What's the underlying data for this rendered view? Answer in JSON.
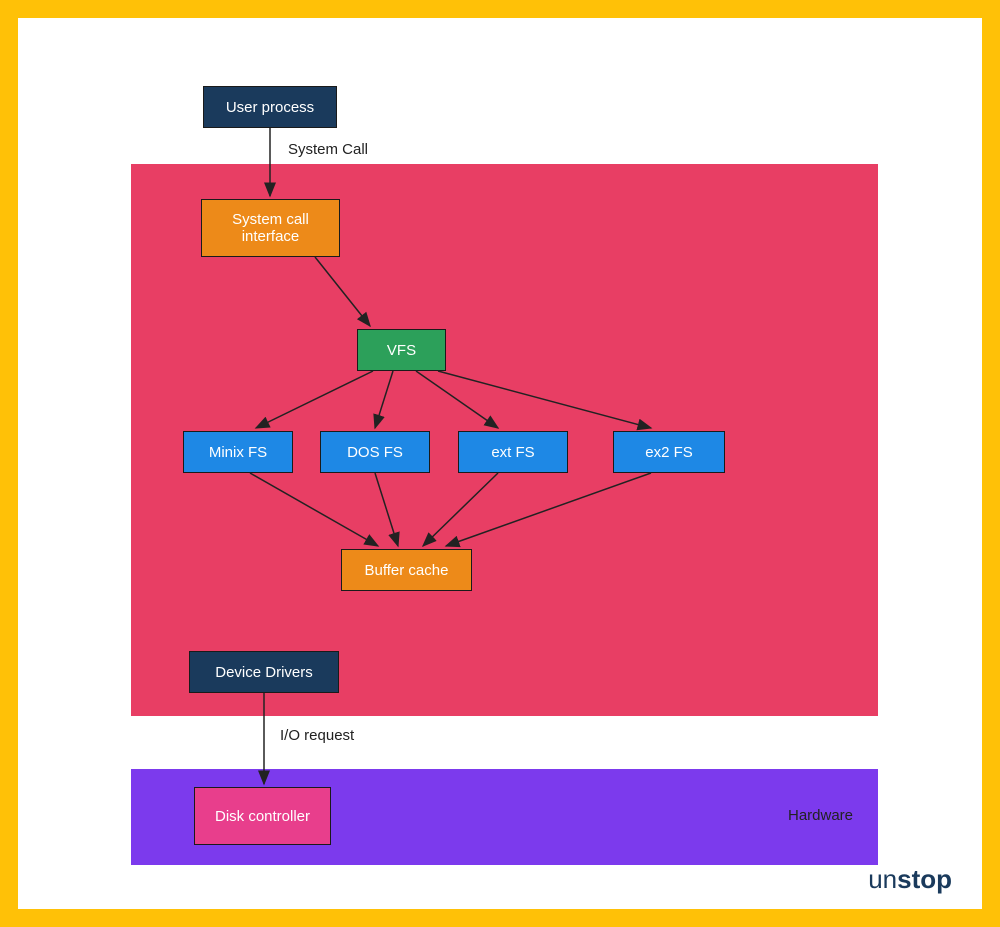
{
  "nodes": {
    "user_process": "User process",
    "system_call_interface": "System call interface",
    "vfs": "VFS",
    "minix_fs": "Minix FS",
    "dos_fs": "DOS FS",
    "ext_fs": "ext FS",
    "ex2_fs": "ex2 FS",
    "buffer_cache": "Buffer cache",
    "device_drivers": "Device Drivers",
    "disk_controller": "Disk controller"
  },
  "labels": {
    "system_call": "System Call",
    "io_request": "I/O request",
    "hardware": "Hardware"
  },
  "logo": {
    "prefix": "un",
    "suffix": "stop"
  },
  "colors": {
    "frame_border": "#FFC107",
    "navy": "#1a3a5c",
    "orange": "#ed8a19",
    "green": "#2ca05a",
    "blue": "#1e88e5",
    "kernel_bg": "#e83e64",
    "hardware_bg": "#7c3aed",
    "pink": "#e83e8c"
  }
}
